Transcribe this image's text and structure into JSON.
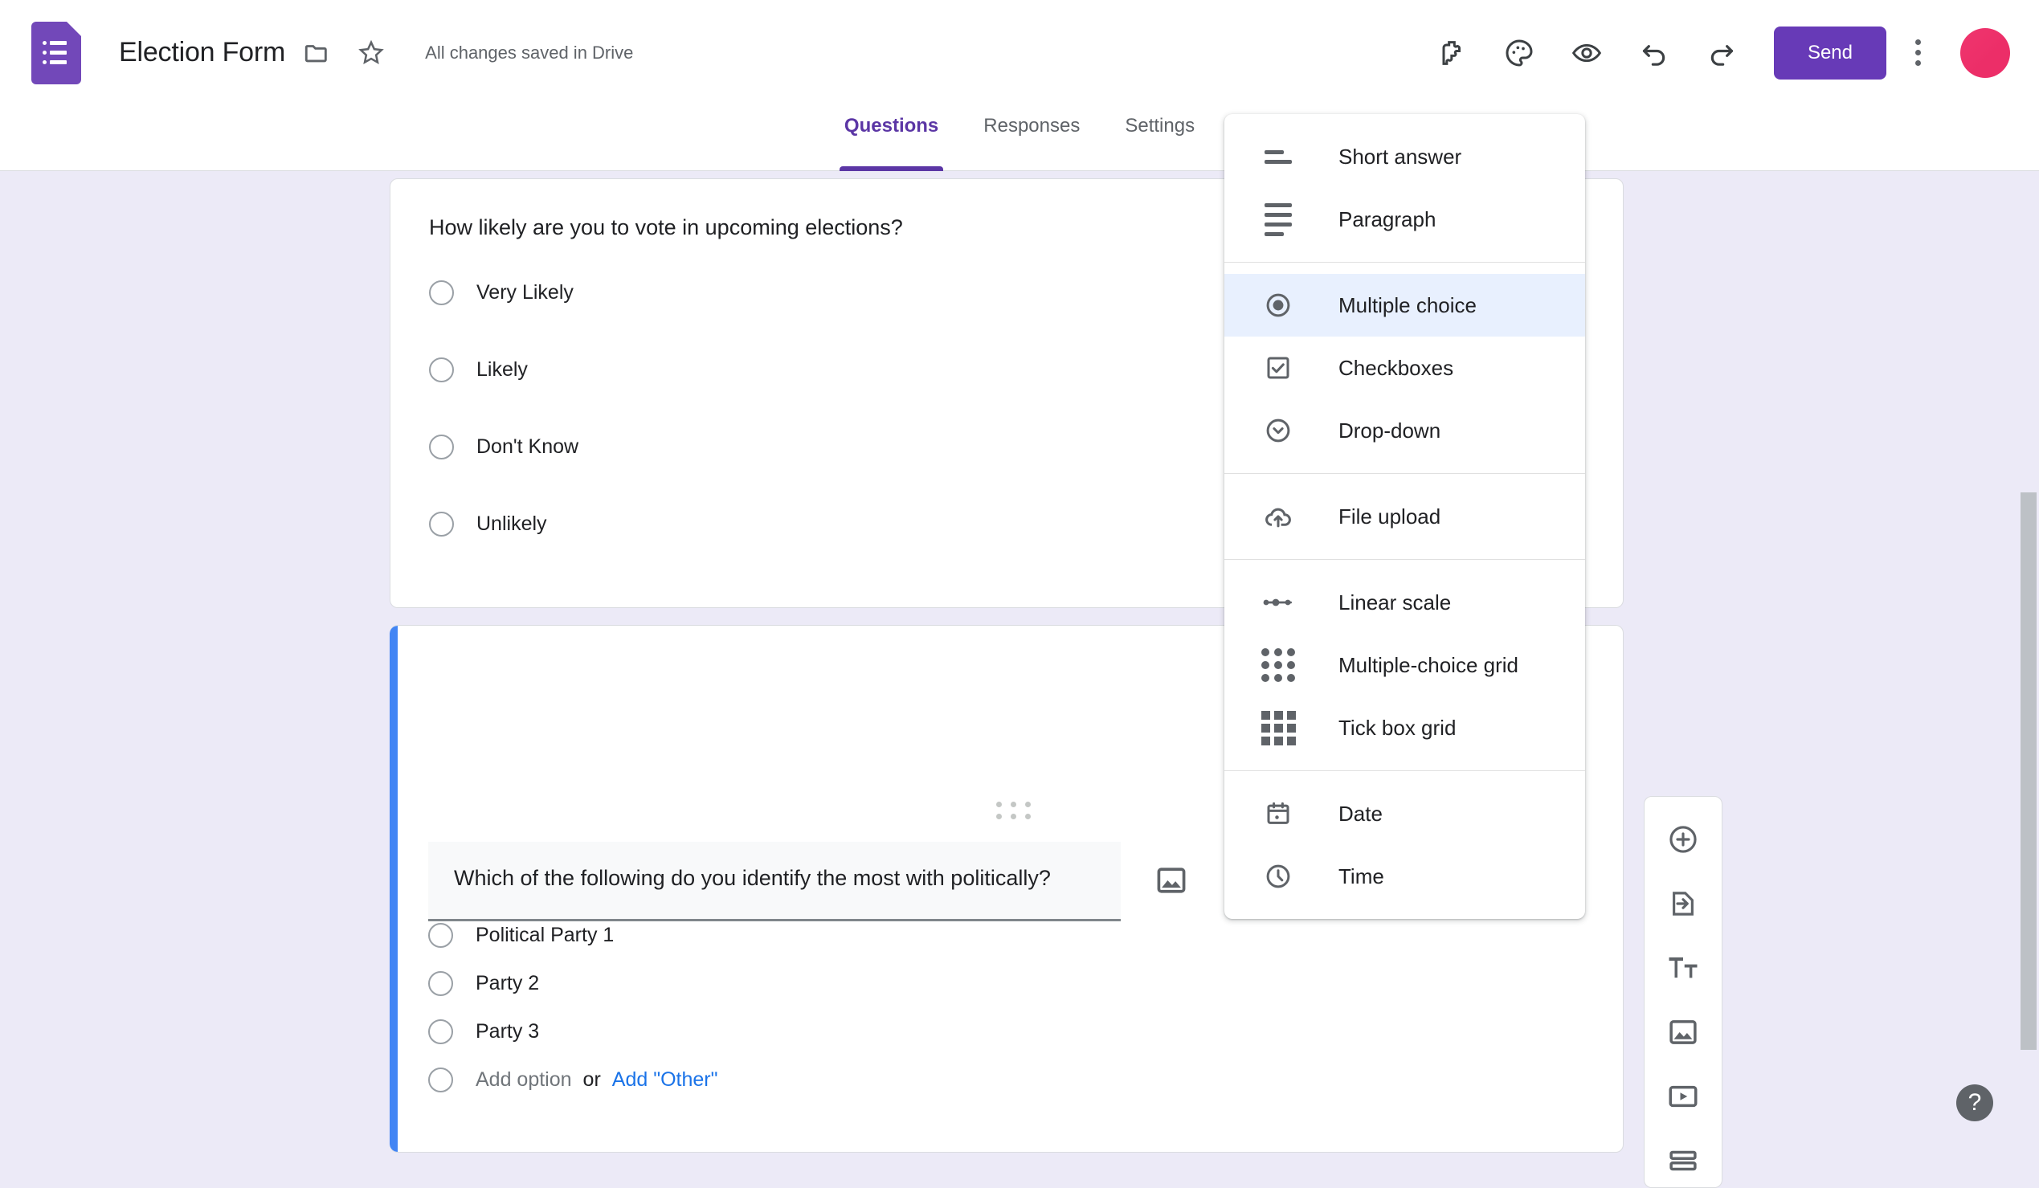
{
  "header": {
    "logo_icon": "google-forms-logo-icon",
    "doc_title": "Election Form",
    "folder_icon": "folder-icon",
    "star_icon": "star-icon",
    "save_status": "All changes saved in Drive",
    "tools": [
      {
        "icon": "addons-puzzle-icon",
        "name": "addons-button"
      },
      {
        "icon": "palette-icon",
        "name": "customize-theme-button"
      },
      {
        "icon": "eye-icon",
        "name": "preview-button"
      },
      {
        "icon": "undo-icon",
        "name": "undo-button"
      },
      {
        "icon": "redo-icon",
        "name": "redo-button"
      }
    ],
    "send_label": "Send",
    "more_icon": "kebab-more-icon",
    "avatar_icon": "user-avatar",
    "accent_color": "#673AB7"
  },
  "tabs": [
    {
      "label": "Questions",
      "active": true
    },
    {
      "label": "Responses",
      "active": false
    },
    {
      "label": "Settings",
      "active": false
    }
  ],
  "questions": [
    {
      "title": "How likely are you to vote in upcoming elections?",
      "options": [
        "Very Likely",
        "Likely",
        "Don't Know",
        "Unlikely"
      ]
    },
    {
      "title": "Which of the following do you identify the most with politically?",
      "options": [
        "Political Party 1",
        "Party 2",
        "Party 3"
      ],
      "add_option_label": "Add option",
      "or_label": "or",
      "add_other_label": "Add \"Other\"",
      "image_icon": "image-icon",
      "drag_handle_icon": "drag-handle-icon",
      "accent_color": "#4285F4"
    }
  ],
  "question_type_menu": {
    "groups": [
      {
        "items": [
          {
            "label": "Short answer",
            "icon": "short-answer-icon",
            "selected": false
          },
          {
            "label": "Paragraph",
            "icon": "paragraph-icon",
            "selected": false
          }
        ]
      },
      {
        "items": [
          {
            "label": "Multiple choice",
            "icon": "radio-button-icon",
            "selected": true
          },
          {
            "label": "Checkboxes",
            "icon": "checkbox-icon",
            "selected": false
          },
          {
            "label": "Drop-down",
            "icon": "chevron-down-circle-icon",
            "selected": false
          }
        ]
      },
      {
        "items": [
          {
            "label": "File upload",
            "icon": "cloud-upload-icon",
            "selected": false
          }
        ]
      },
      {
        "items": [
          {
            "label": "Linear scale",
            "icon": "linear-scale-icon",
            "selected": false
          },
          {
            "label": "Multiple-choice grid",
            "icon": "dot-grid-icon",
            "selected": false
          },
          {
            "label": "Tick box grid",
            "icon": "square-grid-icon",
            "selected": false
          }
        ]
      },
      {
        "items": [
          {
            "label": "Date",
            "icon": "calendar-icon",
            "selected": false
          },
          {
            "label": "Time",
            "icon": "clock-icon",
            "selected": false
          }
        ]
      }
    ],
    "selected_highlight_color": "#E8F0FE"
  },
  "side_toolbar": [
    {
      "icon": "add-question-icon",
      "name": "add-question-button"
    },
    {
      "icon": "import-questions-icon",
      "name": "import-questions-button"
    },
    {
      "icon": "add-title-description-icon",
      "name": "add-title-description-button"
    },
    {
      "icon": "add-image-icon",
      "name": "add-image-button"
    },
    {
      "icon": "add-video-icon",
      "name": "add-video-button"
    },
    {
      "icon": "add-section-icon",
      "name": "add-section-button"
    }
  ],
  "help": {
    "label": "?",
    "icon": "help-icon"
  },
  "page_background": "#ECEAF7"
}
